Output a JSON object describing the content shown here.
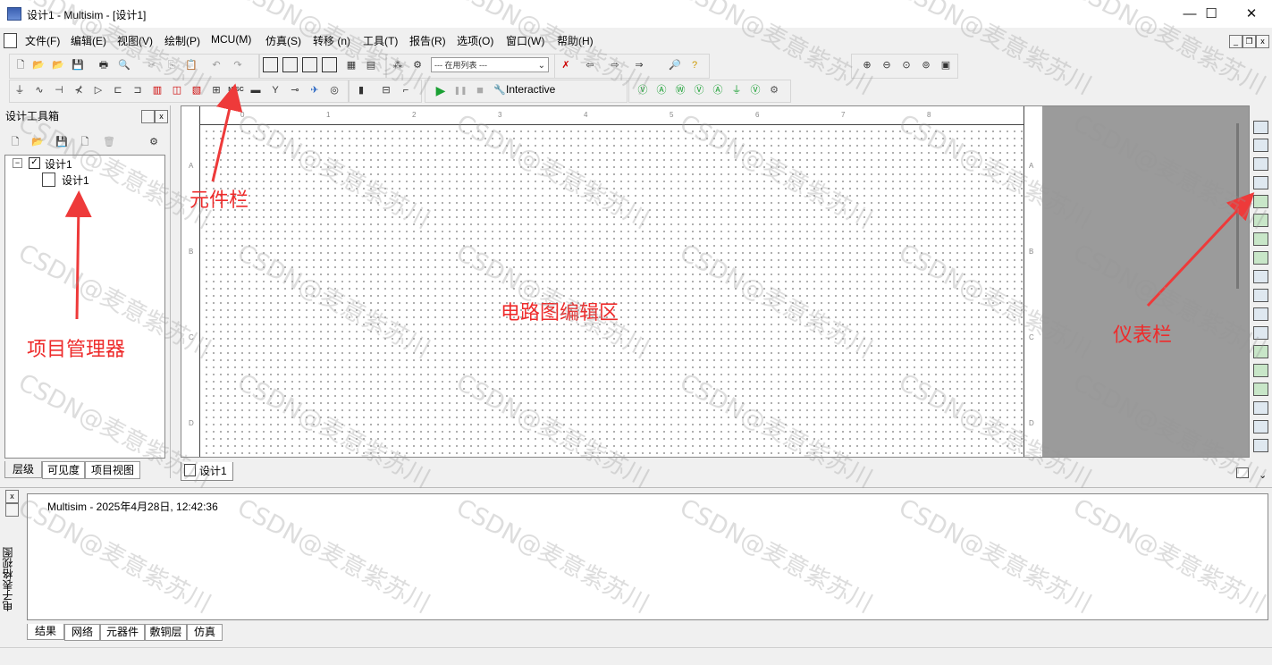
{
  "window": {
    "title": "设计1 - Multisim - [设计1]",
    "minimize": "—",
    "maximize": "☐",
    "close": "✕"
  },
  "menu": {
    "items": [
      "文件(F)",
      "编辑(E)",
      "视图(V)",
      "绘制(P)",
      "MCU(M)",
      "仿真(S)",
      "转移 (n)",
      "工具(T)",
      "报告(R)",
      "选项(O)",
      "窗口(W)",
      "帮助(H)"
    ],
    "mdi_min": "_",
    "mdi_restore": "❐",
    "mdi_close": "x"
  },
  "toolbar": {
    "inuse_list": "--- 在用列表 ---",
    "sim_run": "▶",
    "sim_pause": "❚❚",
    "sim_stop": "■",
    "interactive": "Interactive",
    "misc_label": "MISC"
  },
  "design_toolbox": {
    "title": "设计工具箱",
    "tree_root": "设计1",
    "tree_child": "设计1",
    "tabs": [
      "层级",
      "可见度",
      "项目视图"
    ]
  },
  "canvas": {
    "ruler_cols": [
      "0",
      "1",
      "2",
      "3",
      "4",
      "5",
      "6",
      "7",
      "8"
    ],
    "ruler_rows": [
      "A",
      "B",
      "C",
      "D"
    ],
    "doc_tab": "设计1"
  },
  "spreadsheet": {
    "vertical_label": "电子表格视图",
    "log_line": "Multisim  -  2025年4月28日, 12:42:36",
    "tabs": [
      "结果",
      "网络",
      "元器件",
      "敷铜层",
      "仿真"
    ]
  },
  "annotations": {
    "component_bar": "元件栏",
    "project_manager": "项目管理器",
    "editor_area": "电路图编辑区",
    "instrument_bar": "仪表栏"
  },
  "watermark": "CSDN@麦意紫苏川",
  "colors": {
    "annotation": "#ee2b2b",
    "run_green": "#1aa033"
  }
}
